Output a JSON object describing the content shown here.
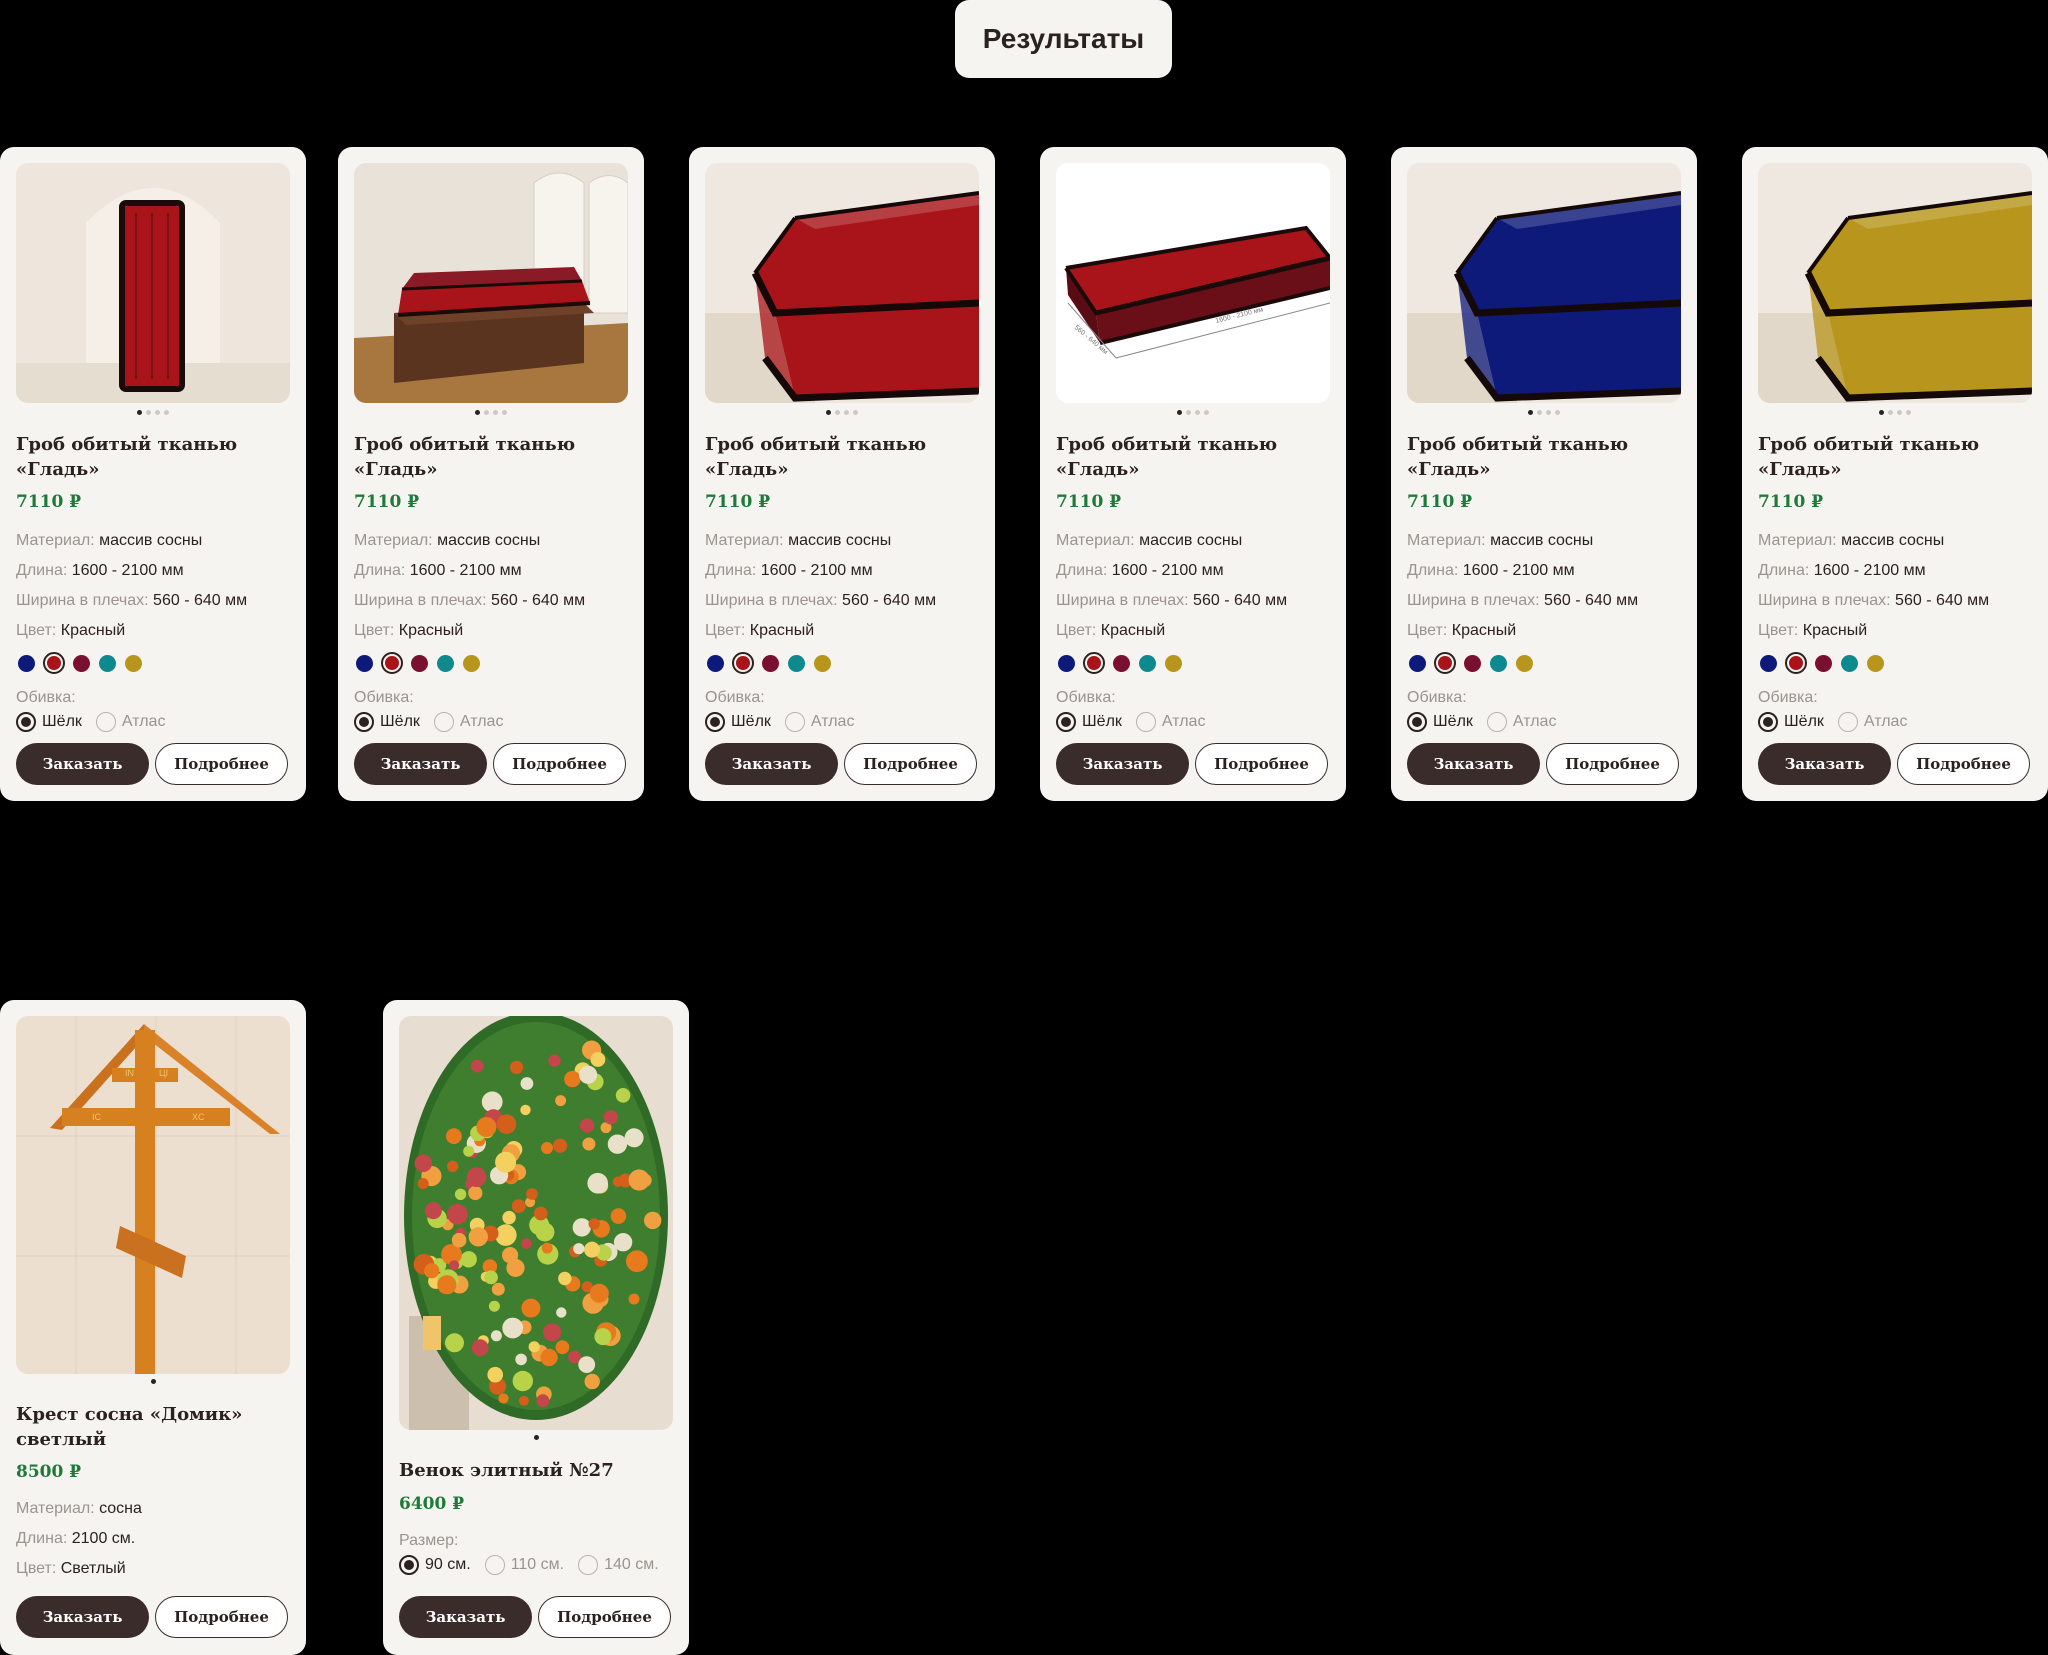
{
  "page_title": "Результаты",
  "coffins": [
    {
      "title": "Гроб обитый тканью «Гладь»",
      "price": "7110 ₽"
    },
    {
      "title": "Гроб обитый тканью «Гладь»",
      "price": "7110 ₽"
    },
    {
      "title": "Гроб обитый тканью «Гладь»",
      "price": "7110 ₽"
    },
    {
      "title": "Гроб обитый тканью «Гладь»",
      "price": "7110 ₽"
    },
    {
      "title": "Гроб обитый тканью «Гладь»",
      "price": "7110 ₽"
    },
    {
      "title": "Гроб обитый тканью «Гладь»",
      "price": "7110 ₽"
    }
  ],
  "coffin_specs": {
    "material_label": "Материал:",
    "material_value": "массив сосны",
    "length_label": "Длина:",
    "length_value": "1600 - 2100 мм",
    "shoulder_label": "Ширина в плечах:",
    "shoulder_value": "560 - 640 мм",
    "color_label": "Цвет:",
    "color_value": "Красный",
    "upholstery_label": "Обивка:",
    "upholstery_options": [
      "Шёлк",
      "Атлас"
    ],
    "upholstery_selected": "Шёлк"
  },
  "color_swatches": [
    "#0e1a7a",
    "#a8141a",
    "#7a1030",
    "#0e8a8e",
    "#b8951c"
  ],
  "selected_color": "#a8141a",
  "cross": {
    "title": "Крест сосна «Домик» светлый",
    "price": "8500 ₽",
    "material_label": "Материал:",
    "material_value": "сосна",
    "length_label": "Длина:",
    "length_value": "2100 см.",
    "color_label": "Цвет:",
    "color_value": "Светлый",
    "cross_letters": [
      "IN",
      "ЦI",
      "IC",
      "XC"
    ]
  },
  "wreath": {
    "title": "Венок элитный №27",
    "price": "6400 ₽",
    "size_label": "Размер:",
    "size_options": [
      "90 см.",
      "110 см.",
      "140 см."
    ],
    "size_selected": "90 см."
  },
  "buttons": {
    "order": "Заказать",
    "details": "Подробнее"
  },
  "photo_dims": {
    "length": "1600 - 2100 мм",
    "width": "560 - 640 мм"
  }
}
